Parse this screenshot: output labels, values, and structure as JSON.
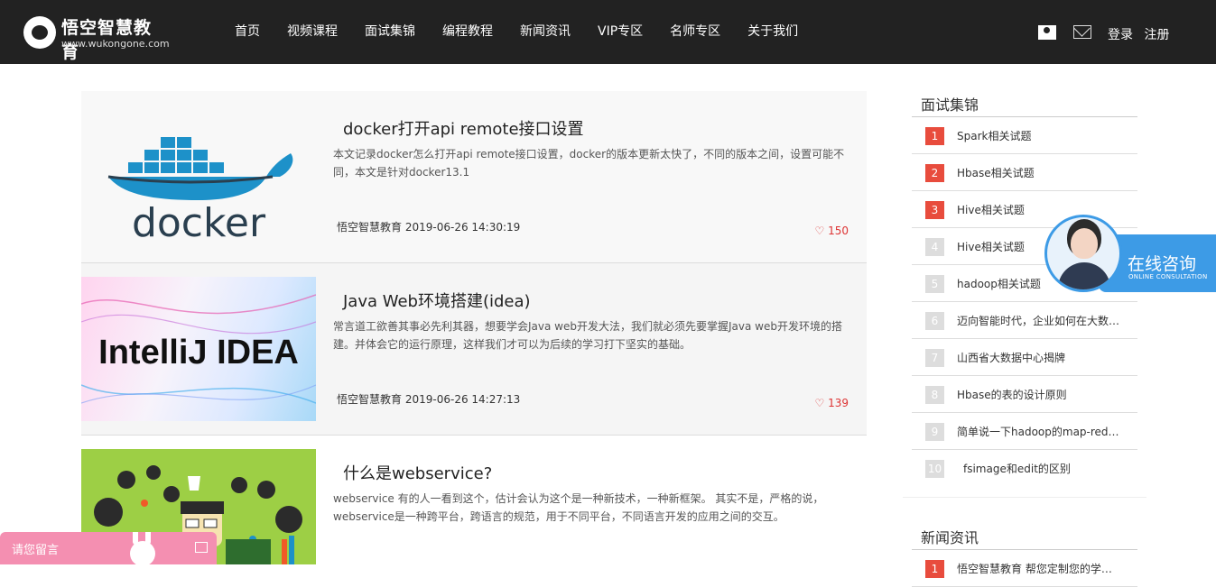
{
  "header": {
    "logo_title": "悟空智慧教育",
    "logo_url": "www.wukongone.com",
    "nav": [
      "首页",
      "视频课程",
      "面试集锦",
      "编程教程",
      "新闻资讯",
      "VIP专区",
      "名师专区",
      "关于我们"
    ],
    "login": "登录",
    "register": "注册"
  },
  "articles": [
    {
      "title": "docker打开api remote接口设置",
      "summary": "本文记录docker怎么打开api remote接口设置，docker的版本更新太快了，不同的版本之间，设置可能不同，本文是针对docker13.1",
      "author": "悟空智慧教育",
      "date": "2019-06-26 14:30:19",
      "likes": "150",
      "thumb_text": "docker"
    },
    {
      "title": "Java Web环境搭建(idea)",
      "summary": "常言道工欲善其事必先利其器，想要学会Java web开发大法，我们就必须先要掌握Java web开发环境的搭建。并体会它的运行原理，这样我们才可以为后续的学习打下坚实的基础。",
      "author": "悟空智慧教育",
      "date": "2019-06-26 14:27:13",
      "likes": "139",
      "thumb_text": "IntelliJ IDEA"
    },
    {
      "title": "什么是webservice?",
      "summary": "webservice 有的人一看到这个，估计会认为这个是一种新技术，一种新框架。 其实不是，严格的说，webservice是一种跨平台，跨语言的规范，用于不同平台，不同语言开发的应用之间的交互。",
      "author": "",
      "date": "",
      "likes": "",
      "thumb_text": ""
    }
  ],
  "sidebar": {
    "section1_title": "面试集锦",
    "items": [
      {
        "num": "1",
        "text": "Spark相关试题"
      },
      {
        "num": "2",
        "text": "Hbase相关试题"
      },
      {
        "num": "3",
        "text": "Hive相关试题"
      },
      {
        "num": "4",
        "text": "Hive相关试题"
      },
      {
        "num": "5",
        "text": "hadoop相关试题"
      },
      {
        "num": "6",
        "text": "迈向智能时代，企业如何在大数…"
      },
      {
        "num": "7",
        "text": "山西省大数据中心揭牌"
      },
      {
        "num": "8",
        "text": "Hbase的表的设计原则"
      },
      {
        "num": "9",
        "text": "简单说一下hadoop的map-red…"
      },
      {
        "num": "10",
        "text": "fsimage和edit的区别"
      }
    ],
    "section2_title": "新闻资讯",
    "news": [
      {
        "num": "1",
        "text": "悟空智慧教育 帮您定制您的学…"
      }
    ]
  },
  "consult": {
    "title": "在线咨询",
    "subtitle": "ONLINE CONSULTATION"
  },
  "message": {
    "label": "请您留言"
  },
  "colors": {
    "header_bg": "#222222",
    "hot_rank": "#e84c3d",
    "consult_blue": "#3d9be6",
    "message_pink": "#f48fb1"
  }
}
